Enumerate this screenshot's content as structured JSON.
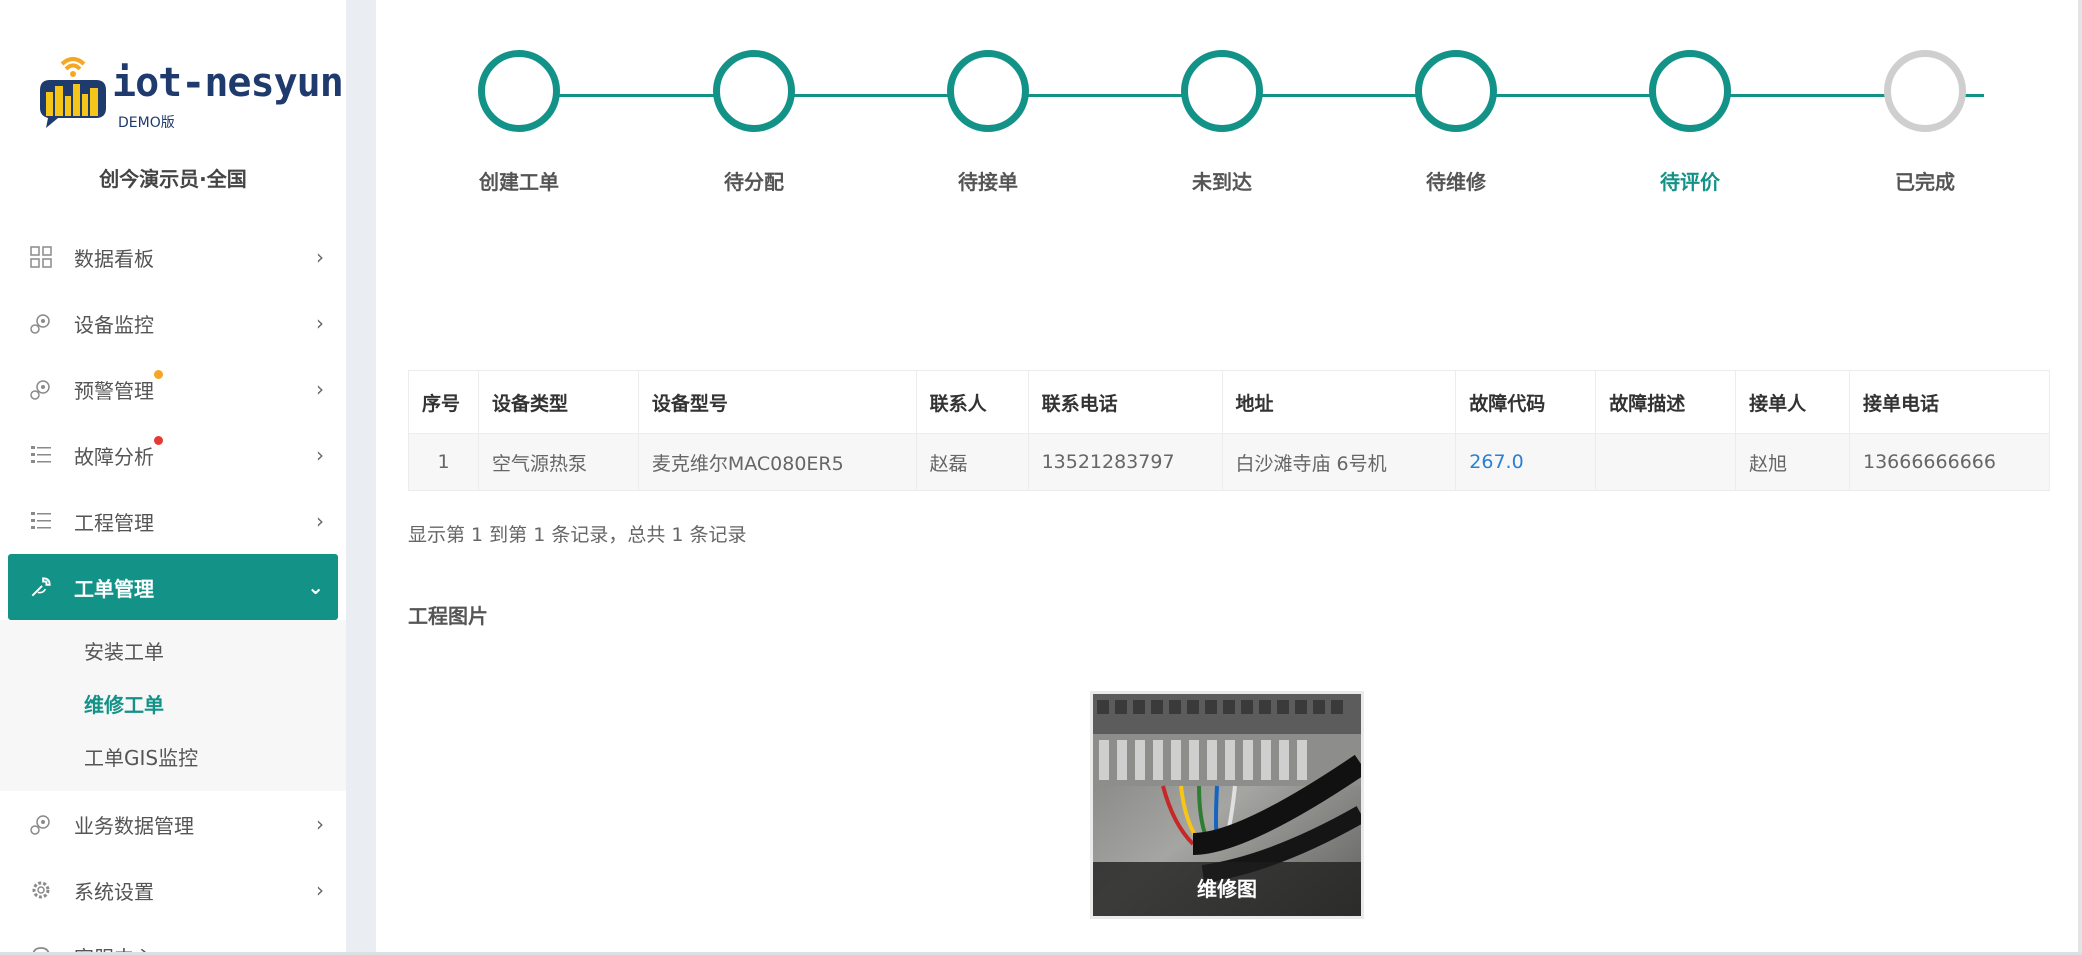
{
  "brand": {
    "name": "iot-nesyun",
    "edition": "DEMO版",
    "colors": {
      "primary": "#139287",
      "brand_text": "#1f3a6d",
      "pending": "#cfcfcf"
    }
  },
  "user": {
    "name": "创今演示员·全国"
  },
  "sidebar": {
    "items": [
      {
        "label": "数据看板",
        "icon": "grid-icon"
      },
      {
        "label": "设备监控",
        "icon": "gear-icon"
      },
      {
        "label": "预警管理",
        "icon": "gear-icon",
        "badge_color": "#f5a623"
      },
      {
        "label": "故障分析",
        "icon": "list-icon",
        "badge_color": "#e53935"
      },
      {
        "label": "工程管理",
        "icon": "list-icon"
      },
      {
        "label": "工单管理",
        "icon": "wrench-icon",
        "active": true,
        "children": [
          {
            "label": "安装工单"
          },
          {
            "label": "维修工单",
            "active": true
          },
          {
            "label": "工单GIS监控"
          }
        ]
      },
      {
        "label": "业务数据管理",
        "icon": "gear-icon"
      },
      {
        "label": "系统设置",
        "icon": "settings-icon"
      },
      {
        "label": "客服中心",
        "icon": "headset-icon"
      }
    ]
  },
  "progress": {
    "steps": [
      {
        "label": "创建工单",
        "state": "done"
      },
      {
        "label": "待分配",
        "state": "done"
      },
      {
        "label": "待接单",
        "state": "done"
      },
      {
        "label": "未到达",
        "state": "done"
      },
      {
        "label": "待维修",
        "state": "done"
      },
      {
        "label": "待评价",
        "state": "current"
      },
      {
        "label": "已完成",
        "state": "todo"
      }
    ]
  },
  "table": {
    "headers": [
      "序号",
      "设备类型",
      "设备型号",
      "联系人",
      "联系电话",
      "地址",
      "故障代码",
      "故障描述",
      "接单人",
      "接单电话"
    ],
    "rows": [
      [
        "1",
        "空气源热泵",
        "麦克维尔MAC080ER5",
        "赵磊",
        "13521283797",
        "白沙滩寺庙 6号机",
        "267.0",
        "",
        "赵旭",
        "13666666666"
      ]
    ]
  },
  "record_info": "显示第 1 到第 1 条记录，总共 1 条记录",
  "photos": {
    "title": "工程图片",
    "items": [
      {
        "caption": "维修图"
      }
    ]
  }
}
